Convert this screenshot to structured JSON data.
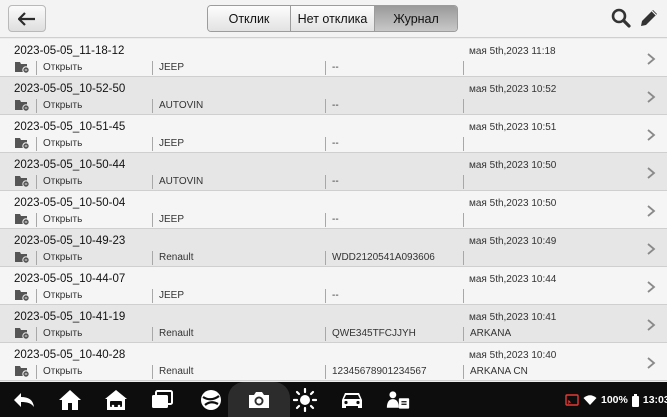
{
  "tabs": [
    {
      "label": "Отклик",
      "active": false
    },
    {
      "label": "Нет отклика",
      "active": false
    },
    {
      "label": "Журнал",
      "active": true
    }
  ],
  "icons": {
    "back": "back-arrow-icon",
    "search": "search-icon",
    "edit": "pencil-icon",
    "record": "file-record-icon",
    "row_chevron": "chevron-right-icon"
  },
  "records": [
    {
      "title": "2023-05-05_11-18-12",
      "date": "мая 5th,2023 11:18",
      "open": "Открыть",
      "brand": "JEEP",
      "vin": "--",
      "model": ""
    },
    {
      "title": "2023-05-05_10-52-50",
      "date": "мая 5th,2023 10:52",
      "open": "Открыть",
      "brand": "AUTOVIN",
      "vin": "--",
      "model": ""
    },
    {
      "title": "2023-05-05_10-51-45",
      "date": "мая 5th,2023 10:51",
      "open": "Открыть",
      "brand": "JEEP",
      "vin": "--",
      "model": ""
    },
    {
      "title": "2023-05-05_10-50-44",
      "date": "мая 5th,2023 10:50",
      "open": "Открыть",
      "brand": "AUTOVIN",
      "vin": "--",
      "model": ""
    },
    {
      "title": "2023-05-05_10-50-04",
      "date": "мая 5th,2023 10:50",
      "open": "Открыть",
      "brand": "JEEP",
      "vin": "--",
      "model": ""
    },
    {
      "title": "2023-05-05_10-49-23",
      "date": "мая 5th,2023 10:49",
      "open": "Открыть",
      "brand": "Renault",
      "vin": "WDD2120541A093606",
      "model": ""
    },
    {
      "title": "2023-05-05_10-44-07",
      "date": "мая 5th,2023 10:44",
      "open": "Открыть",
      "brand": "JEEP",
      "vin": "--",
      "model": ""
    },
    {
      "title": "2023-05-05_10-41-19",
      "date": "мая 5th,2023 10:41",
      "open": "Открыть",
      "brand": "Renault",
      "vin": "QWE345TFCJJYH",
      "model": "ARKANA"
    },
    {
      "title": "2023-05-05_10-40-28",
      "date": "мая 5th,2023 10:40",
      "open": "Открыть",
      "brand": "Renault",
      "vin": "12345678901234567",
      "model": "ARKANA CN"
    }
  ],
  "navbar": {
    "icons": [
      "back-icon",
      "home-icon",
      "car-home-icon",
      "recent-apps-icon",
      "browser-icon",
      "camera-icon",
      "brightness-icon",
      "vci-car-icon",
      "remote-support-icon"
    ],
    "status": {
      "battery": "100%",
      "time": "13:03"
    }
  },
  "colors": {
    "row_light": "#f5f5f5",
    "row_dark": "#e6e6e6",
    "navbar": "#0d0d0d",
    "active_tab": "#a9a9a9"
  }
}
